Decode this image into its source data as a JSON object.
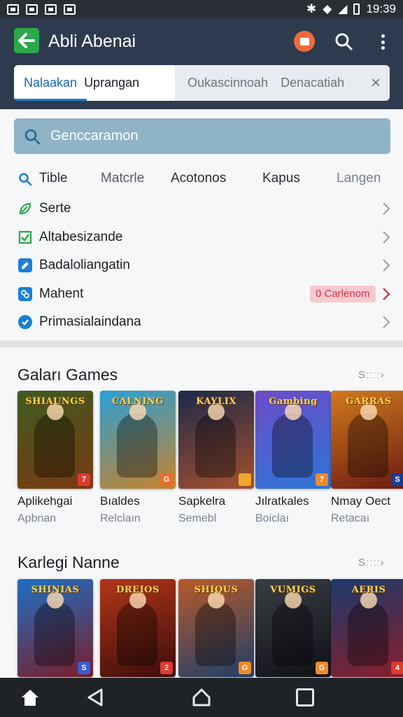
{
  "status_bar": {
    "time": "19:39"
  },
  "app_bar": {
    "title": "Abli Abenai"
  },
  "tabs": {
    "active_a": "Nalaakan",
    "active_b": "Uprangan",
    "inactive_a": "Oukascinnoah",
    "inactive_b": "Denacatiah",
    "close": "×"
  },
  "search": {
    "placeholder": "Genccaramon"
  },
  "filters": [
    "Tible",
    "Matcrle",
    "Acotonos",
    "Kapus",
    "Langen"
  ],
  "menu": [
    {
      "label": "Serte",
      "icon": "leaf-icon",
      "color": "#2aa84a"
    },
    {
      "label": "Altabesizande",
      "icon": "checkbox-icon",
      "color": "#2aa84a"
    },
    {
      "label": "Badaloliangatin",
      "icon": "edit-icon",
      "color": "#1b7fd4"
    },
    {
      "label": "Mahent",
      "icon": "link-icon",
      "color": "#1b7fd4",
      "badge": "0 Carlenom"
    },
    {
      "label": "Primasialaindana",
      "icon": "check-circle-icon",
      "color": "#1b7fd4"
    }
  ],
  "section1": {
    "title": "Gaları Games",
    "see_more": "Sːːːː›",
    "games": [
      {
        "name": "Aplikehgai",
        "sub": "Apbnan",
        "logo": "SHIAUNGS",
        "c1": "#3e5a1f",
        "c2": "#7a3b12",
        "corner": "#e03a2f",
        "corner_text": "7"
      },
      {
        "name": "Bıaldes",
        "sub": "Relclaın",
        "logo": "CALNING",
        "c1": "#2a9fd6",
        "c2": "#c5832a",
        "corner": "#ef6b2d",
        "corner_text": "G"
      },
      {
        "name": "Sapkelra",
        "sub": "Semebl",
        "logo": "KAYLIX",
        "c1": "#1c2a48",
        "c2": "#a5502f",
        "corner": "#f0a52b",
        "corner_text": ""
      },
      {
        "name": "Jılratkales",
        "sub": "Boiclaı",
        "logo": "Gambing",
        "c1": "#6d4bc8",
        "c2": "#2c76d6",
        "corner": "#ef8a2d",
        "corner_text": "7"
      },
      {
        "name": "Nmay Oect",
        "sub": "Retacaı",
        "logo": "GARRAS",
        "c1": "#d07a1e",
        "c2": "#6c1b12",
        "corner": "#1b3c8c",
        "corner_text": "S"
      }
    ]
  },
  "section2": {
    "title": "Karlegi Nanne",
    "see_more": "Sːːːː›",
    "games": [
      {
        "logo": "SHINIAS",
        "c1": "#1d6fc4",
        "c2": "#7a1e28",
        "corner": "#3a5bd6",
        "corner_text": "S"
      },
      {
        "logo": "DREIOS",
        "c1": "#b3361a",
        "c2": "#3b0d0a",
        "corner": "#e03a2f",
        "corner_text": "2"
      },
      {
        "logo": "SHIQUS",
        "c1": "#b85a2a",
        "c2": "#1f3f6a",
        "corner": "#ef8a2d",
        "corner_text": "G"
      },
      {
        "logo": "VUMIGS",
        "c1": "#3a3d45",
        "c2": "#0f1114",
        "corner": "#ef8a2d",
        "corner_text": "G"
      },
      {
        "logo": "AERIS",
        "c1": "#1a3a6c",
        "c2": "#8a1e2a",
        "corner": "#e03a2f",
        "corner_text": "4"
      }
    ]
  }
}
